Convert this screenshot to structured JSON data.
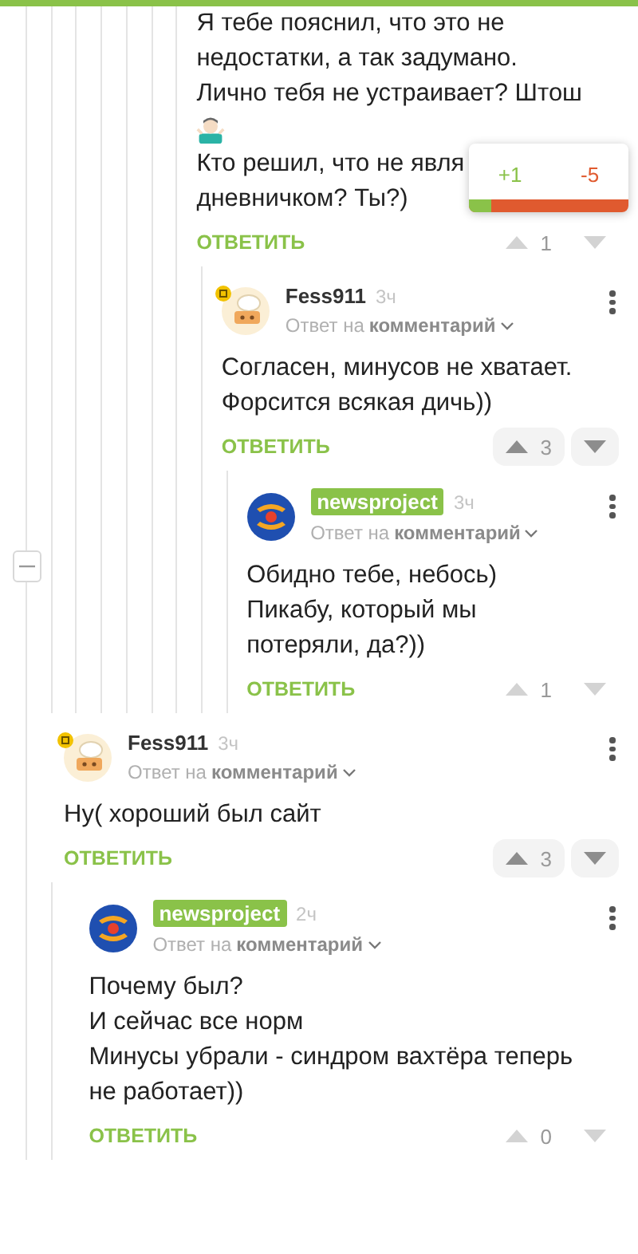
{
  "vote_popup": {
    "plus": "+1",
    "minus": "-5",
    "level": 0.14
  },
  "collapse_button": {
    "expanded": true
  },
  "comments": [
    {
      "body": [
        {
          "kind": "text",
          "text": "Я тебе пояснил, что это не"
        },
        {
          "kind": "text",
          "text": "недостатки, а так задумано."
        },
        {
          "kind": "text",
          "text": "Лично тебя не устраивает? Штош"
        },
        {
          "kind": "emoji"
        },
        {
          "kind": "text",
          "text": "Кто решил, что не явля"
        },
        {
          "kind": "text",
          "text": "дневничком? Ты?)"
        }
      ],
      "reply": "ОТВЕТИТЬ",
      "votes": {
        "count": "1",
        "highlighted": false
      },
      "children": [
        {
          "author": "Fess911",
          "kind": "plain",
          "time": "3ч",
          "reply_to": "Ответ на",
          "reply_target": "комментарий",
          "body": [
            {
              "kind": "text",
              "text": "Согласен, минусов не хватает."
            },
            {
              "kind": "text",
              "text": "Форсится всякая дичь))"
            }
          ],
          "reply": "ОТВЕТИТЬ",
          "votes": {
            "count": "3",
            "highlighted": true
          },
          "children": [
            {
              "author": "newsproject",
              "kind": "tag",
              "time": "3ч",
              "reply_to": "Ответ на",
              "reply_target": "комментарий",
              "body": [
                {
                  "kind": "text",
                  "text": "Обидно тебе, небось)"
                },
                {
                  "kind": "text",
                  "text": "Пикабу, который мы"
                },
                {
                  "kind": "text",
                  "text": "потеряли, да?))"
                }
              ],
              "reply": "ОТВЕТИТЬ",
              "votes": {
                "count": "1",
                "highlighted": false
              }
            }
          ]
        }
      ]
    },
    {
      "author": "Fess911",
      "kind": "plain",
      "time": "3ч",
      "reply_to": "Ответ на",
      "reply_target": "комментарий",
      "body": [
        {
          "kind": "text",
          "text": "Ну( хороший был сайт"
        }
      ],
      "reply": "ОТВЕТИТЬ",
      "votes": {
        "count": "3",
        "highlighted": true
      },
      "children": [
        {
          "author": "newsproject",
          "kind": "tag",
          "time": "2ч",
          "reply_to": "Ответ на",
          "reply_target": "комментарий",
          "body": [
            {
              "kind": "text",
              "text": "Почему был?"
            },
            {
              "kind": "text",
              "text": "И сейчас все норм"
            },
            {
              "kind": "text",
              "text": "Минусы убрали - синдром вахтёра теперь"
            },
            {
              "kind": "text",
              "text": "не работает))"
            }
          ],
          "reply": "ОТВЕТИТЬ",
          "votes": {
            "count": "0",
            "highlighted": false
          }
        }
      ]
    }
  ]
}
